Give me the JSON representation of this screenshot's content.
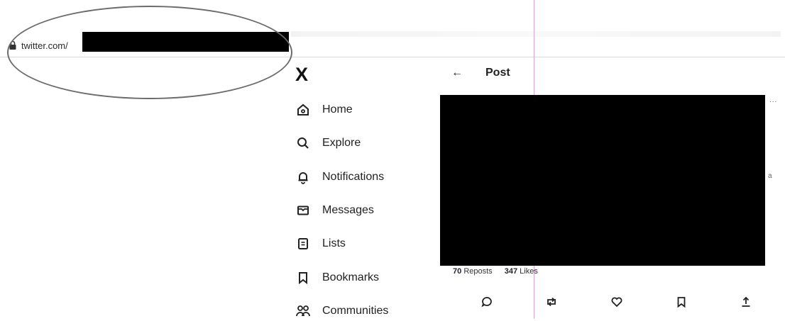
{
  "browser": {
    "url_prefix": "twitter.com/",
    "icons": {
      "lock": "lock-icon"
    }
  },
  "sidebar": {
    "logo": "X",
    "items": [
      {
        "label": "Home",
        "icon": "home-icon"
      },
      {
        "label": "Explore",
        "icon": "search-icon"
      },
      {
        "label": "Notifications",
        "icon": "bell-icon"
      },
      {
        "label": "Messages",
        "icon": "envelope-icon"
      },
      {
        "label": "Lists",
        "icon": "list-icon"
      },
      {
        "label": "Bookmarks",
        "icon": "bookmark-icon"
      },
      {
        "label": "Communities",
        "icon": "communities-icon"
      }
    ]
  },
  "post": {
    "back_arrow": "←",
    "title": "Post",
    "more": "...",
    "stray_char": "a",
    "reposts_count": "70",
    "reposts_label": "Reposts",
    "likes_count": "347",
    "likes_label": "Likes",
    "actions": [
      "reply-icon",
      "repost-icon",
      "like-icon",
      "bookmark-icon",
      "share-icon"
    ]
  }
}
